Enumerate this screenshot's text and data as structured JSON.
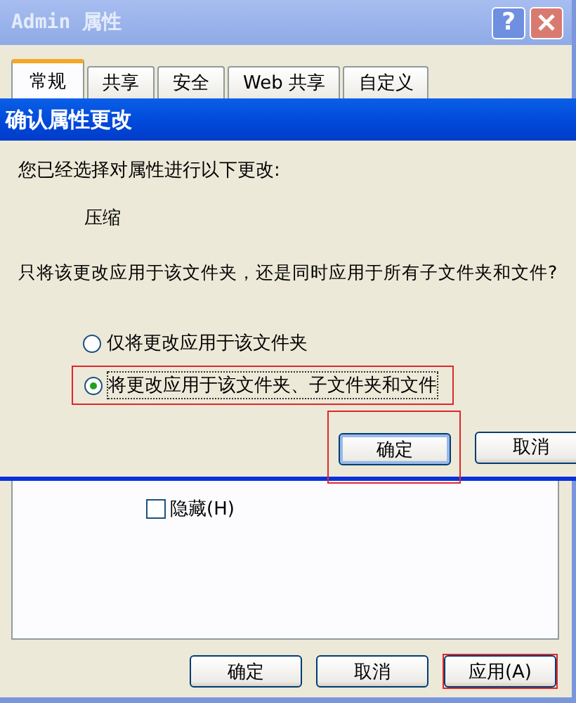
{
  "window": {
    "title": "Admin 属性",
    "help": "?"
  },
  "tabs": [
    {
      "label": "常规",
      "selected": true
    },
    {
      "label": "共享",
      "selected": false
    },
    {
      "label": "安全",
      "selected": false
    },
    {
      "label": "Web 共享",
      "selected": false
    },
    {
      "label": "自定义",
      "selected": false
    }
  ],
  "hidden_checkbox": {
    "label": "隐藏(H)",
    "checked": false
  },
  "buttons": [
    {
      "label": "确定",
      "highlighted": false
    },
    {
      "label": "取消",
      "highlighted": false
    },
    {
      "label": "应用(A)",
      "highlighted": true
    }
  ],
  "dialog": {
    "title": "确认属性更改",
    "intro": "您已经选择对属性进行以下更改:",
    "change": "压缩",
    "question": "只将该更改应用于该文件夹，还是同时应用于所有子文件夹和文件?",
    "options": [
      {
        "label": "仅将更改应用于该文件夹",
        "selected": false,
        "highlighted": false
      },
      {
        "label": "将更改应用于该文件夹、子文件夹和文件",
        "selected": true,
        "highlighted": true
      }
    ],
    "buttons": [
      {
        "label": "确定",
        "default": true,
        "highlighted": true
      },
      {
        "label": "取消",
        "default": false,
        "highlighted": false
      }
    ]
  }
}
